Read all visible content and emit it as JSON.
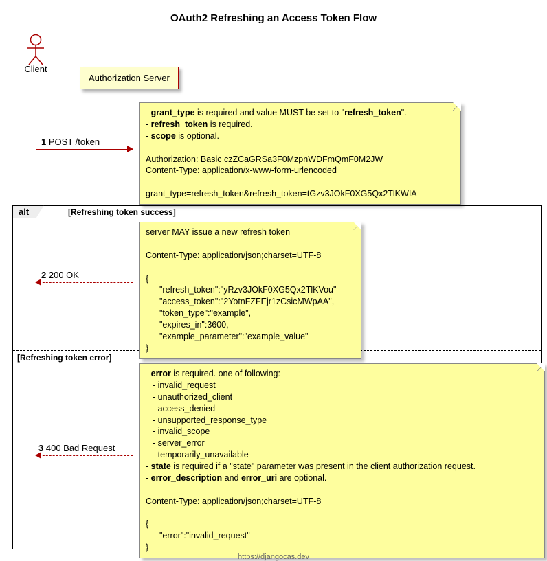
{
  "title": "OAuth2 Refreshing an Access Token Flow",
  "actor_label": "Client",
  "participant_label": "Authorization Server",
  "msg1": {
    "num": "1",
    "text": "POST /token"
  },
  "note1": {
    "l1a": "grant_type",
    "l1b": " is required and value MUST be set to \"",
    "l1c": "refresh_token",
    "l1d": "\".",
    "l2a": "refresh_token",
    "l2b": " is required.",
    "l3a": "scope",
    "l3b": " is optional.",
    "auth": "Authorization: Basic czZCaGRSa3F0MzpnWDFmQmF0M2JW",
    "ct": "Content-Type: application/x-www-form-urlencoded",
    "body": "grant_type=refresh_token&refresh_token=tGzv3JOkF0XG5Qx2TlKWIA"
  },
  "frame": {
    "tag": "alt",
    "cond1": "[Refreshing token success]",
    "cond2": "[Refreshing token error]"
  },
  "msg2": {
    "num": "2",
    "text": "200 OK"
  },
  "note2": {
    "intro": "server MAY issue a new refresh token",
    "ct": "Content-Type: application/json;charset=UTF-8",
    "ob": "{",
    "l1": "\"refresh_token\":\"yRzv3JOkF0XG5Qx2TlKVou\"",
    "l2": "\"access_token\":\"2YotnFZFEjr1zCsicMWpAA\",",
    "l3": "\"token_type\":\"example\",",
    "l4": "\"expires_in\":3600,",
    "l5": "\"example_parameter\":\"example_value\"",
    "cb": "}"
  },
  "msg3": {
    "num": "3",
    "text": "400 Bad Request"
  },
  "note3": {
    "e_label": "error",
    "e_rest": " is required. one of following:",
    "e1": "invalid_request",
    "e2": "unauthorized_client",
    "e3": "access_denied",
    "e4": "unsupported_response_type",
    "e5": "invalid_scope",
    "e6": "server_error",
    "e7": "temporarily_unavailable",
    "s_label": "state",
    "s_rest": " is required if a \"state\" parameter was present in the client authorization request.",
    "ed_label1": "error_description",
    "ed_mid": " and ",
    "ed_label2": "error_uri",
    "ed_rest": " are optional.",
    "ct": "Content-Type: application/json;charset=UTF-8",
    "ob": "{",
    "l1": "\"error\":\"invalid_request\"",
    "cb": "}"
  },
  "footer_text": "https://djangocas.dev"
}
